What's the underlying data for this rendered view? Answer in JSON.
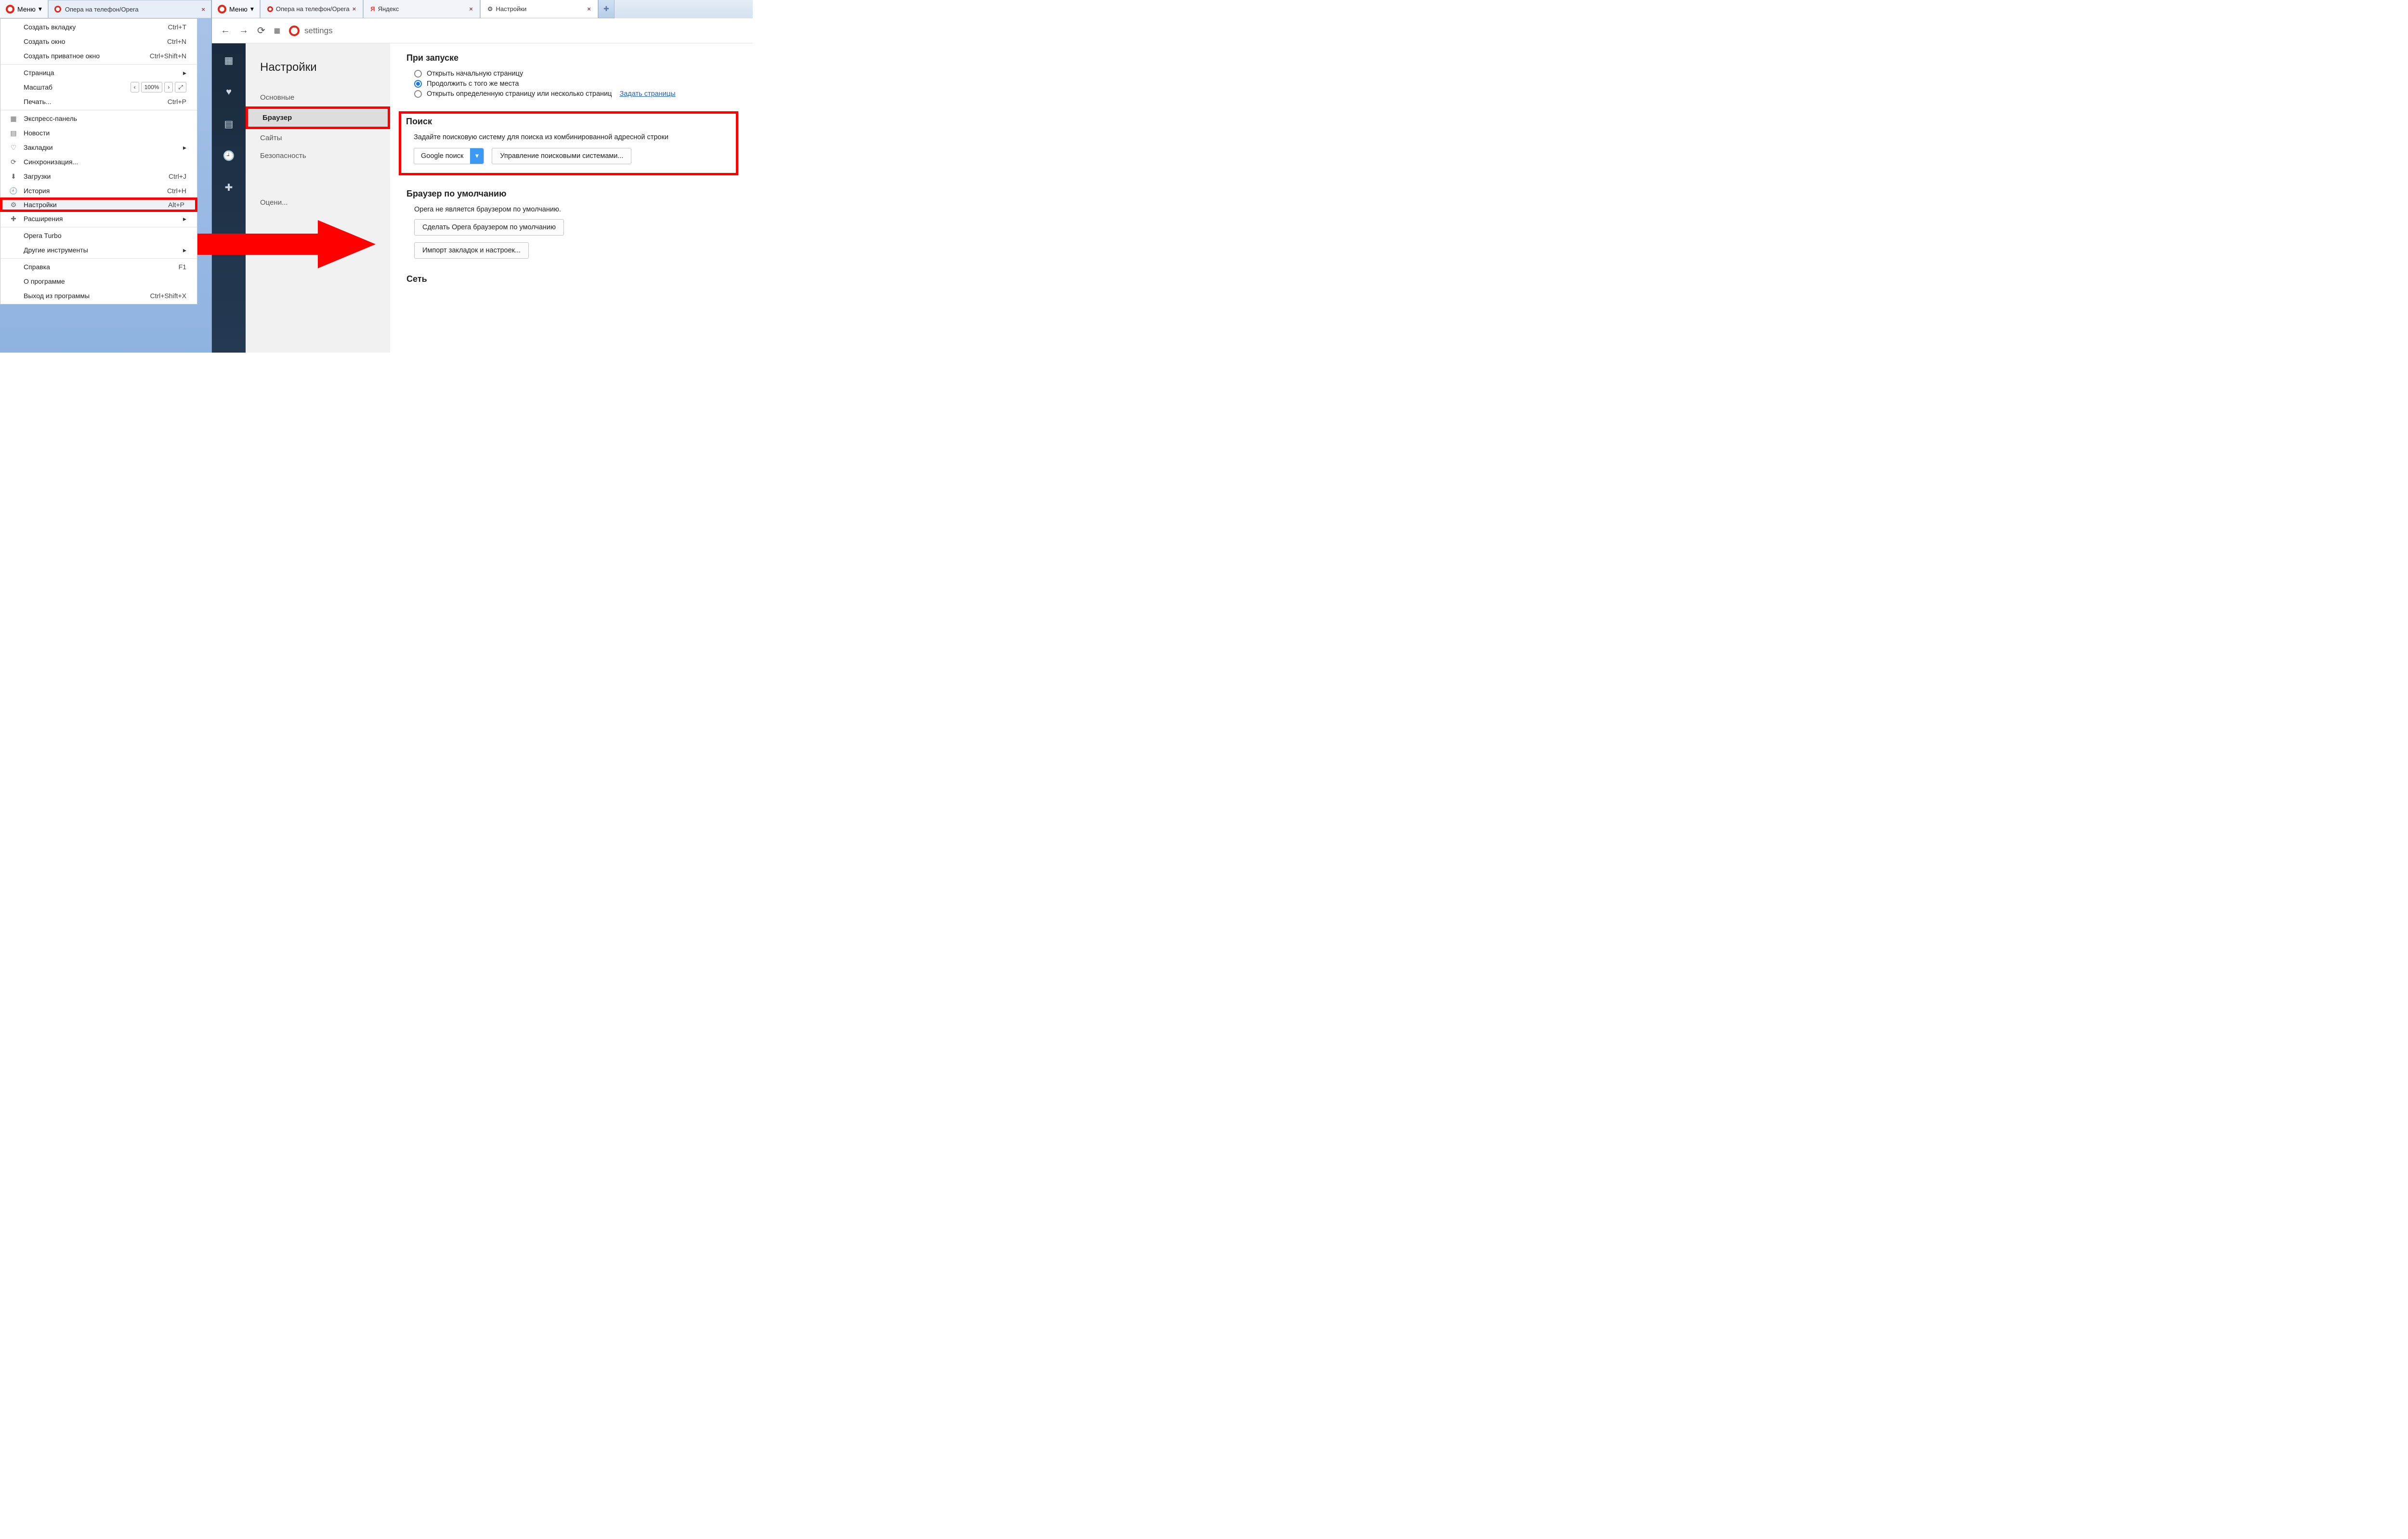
{
  "left": {
    "menu_label": "Меню",
    "tab1_label": "Опера на телефон/Opera",
    "dropdown": {
      "s1": {
        "new_tab": "Создать вкладку",
        "new_tab_sc": "Ctrl+T",
        "new_window": "Создать окно",
        "new_window_sc": "Ctrl+N",
        "new_private": "Создать приватное окно",
        "new_private_sc": "Ctrl+Shift+N"
      },
      "s2": {
        "page": "Страница",
        "zoom": "Масштаб",
        "zoom_val": "100%",
        "print": "Печать...",
        "print_sc": "Ctrl+P"
      },
      "s3": {
        "speed_dial": "Экспресс-панель",
        "news": "Новости",
        "bookmarks": "Закладки",
        "sync": "Синхронизация...",
        "downloads": "Загрузки",
        "downloads_sc": "Ctrl+J",
        "history": "История",
        "history_sc": "Ctrl+H",
        "settings": "Настройки",
        "settings_sc": "Alt+P",
        "extensions": "Расширения"
      },
      "s4": {
        "turbo": "Opera Turbo",
        "devtools": "Другие инструменты"
      },
      "s5": {
        "help": "Справка",
        "help_sc": "F1",
        "about": "О программе",
        "exit": "Выход из программы",
        "exit_sc": "Ctrl+Shift+X"
      }
    }
  },
  "right": {
    "menu_label": "Меню",
    "tabs": {
      "t1": "Опера на телефон/Opera",
      "t2": "Яндекс",
      "t3": "Настройки"
    },
    "address_value": "settings",
    "sidebar_title": "Настройки",
    "sidebar_items": {
      "basic": "Основные",
      "browser": "Браузер",
      "sites": "Сайты",
      "security": "Безопасность",
      "rate": "Оцени..."
    },
    "startup": {
      "heading": "При запуске",
      "r1": "Открыть начальную страницу",
      "r2": "Продолжить с того же места",
      "r3": "Открыть определенную страницу или несколько страниц",
      "r3_link": "Задать страницы"
    },
    "search": {
      "heading": "Поиск",
      "desc": "Задайте поисковую систему для поиска из комбинированной адресной строки",
      "engine": "Google поиск",
      "manage": "Управление поисковыми системами..."
    },
    "default_browser": {
      "heading": "Браузер по умолчанию",
      "msg": "Opera не является браузером по умолчанию.",
      "make_default": "Сделать Opera браузером по умолчанию",
      "import": "Импорт закладок и настроек..."
    },
    "network": {
      "heading": "Сеть"
    }
  }
}
